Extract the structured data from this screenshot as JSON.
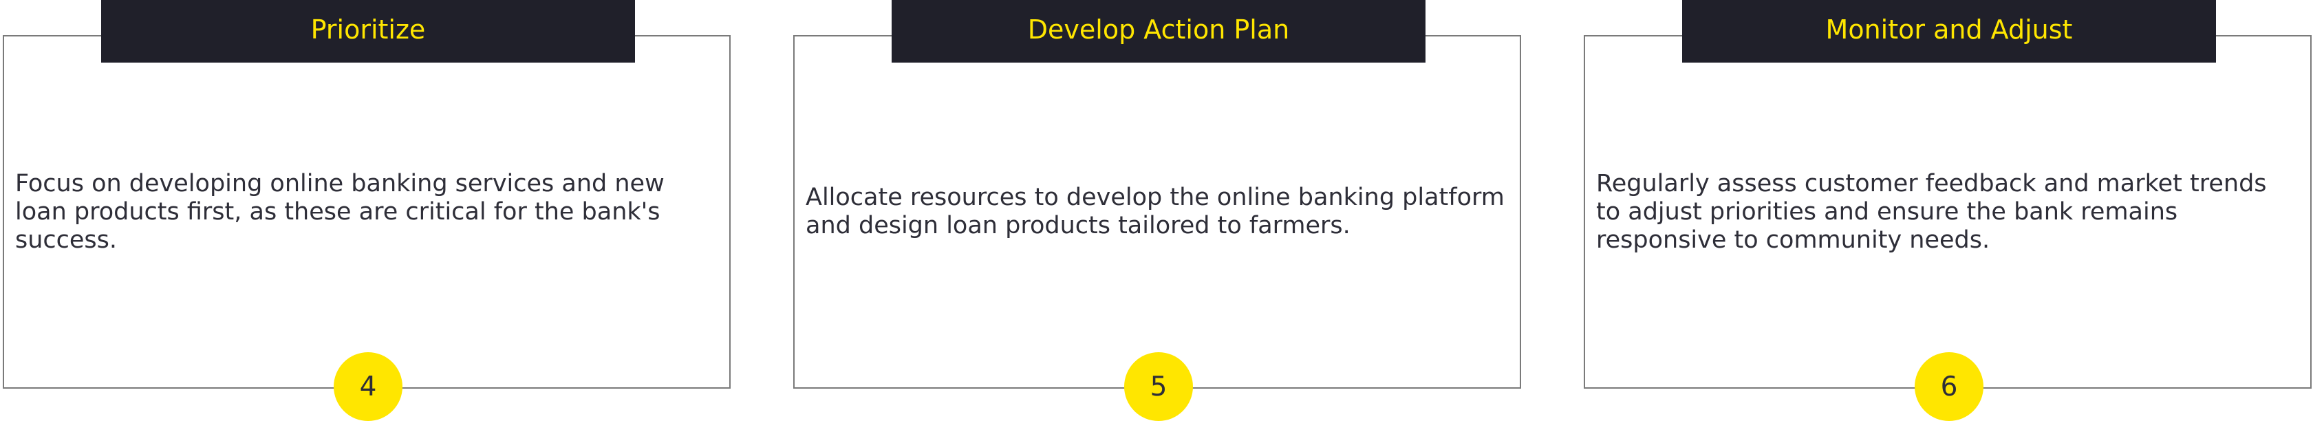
{
  "steps": [
    {
      "title": "Prioritize",
      "description": "Focus on developing online banking services and new loan products first, as these are critical for the bank's success.",
      "number": "4"
    },
    {
      "title": "Develop Action Plan",
      "description": "Allocate resources to develop the online banking platform and design loan products tailored to farmers.",
      "number": "5"
    },
    {
      "title": "Monitor and Adjust",
      "description": "Regularly assess customer feedback and market trends to adjust priorities and ensure the bank remains responsive to community needs.",
      "number": "6"
    }
  ],
  "colors": {
    "header_bg": "#20202a",
    "accent_yellow": "#ffe600",
    "text": "#2e2e38",
    "border": "#7a7a7a"
  }
}
